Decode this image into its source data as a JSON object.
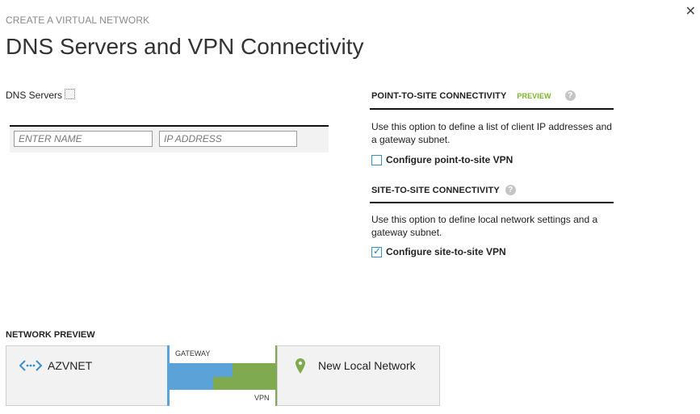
{
  "header": {
    "wizard_step": "CREATE A VIRTUAL NETWORK",
    "title": "DNS Servers and VPN Connectivity",
    "close_label": "✕"
  },
  "dns": {
    "label": "DNS Servers",
    "name_placeholder": "ENTER NAME",
    "ip_placeholder": "IP ADDRESS"
  },
  "point_to_site": {
    "heading": "POINT-TO-SITE CONNECTIVITY",
    "badge": "PREVIEW",
    "help": "?",
    "description": "Use this option to define a list of client IP addresses and a gateway subnet.",
    "checkbox_label": "Configure point-to-site VPN",
    "checked": false
  },
  "site_to_site": {
    "heading": "SITE-TO-SITE CONNECTIVITY",
    "help": "?",
    "description": "Use this option to define local network settings and a gateway subnet.",
    "checkbox_label": "Configure site-to-site VPN",
    "checked": true
  },
  "network_preview": {
    "label": "NETWORK PREVIEW",
    "vnet_name": "AZVNET",
    "vnet_icon": "vnet-icon",
    "gateway_label": "GATEWAY",
    "vpn_label": "VPN",
    "local_network_name": "New Local Network",
    "local_icon": "map-pin-icon",
    "colors": {
      "vnet": "#5aa2d8",
      "local": "#7faa4f"
    }
  }
}
